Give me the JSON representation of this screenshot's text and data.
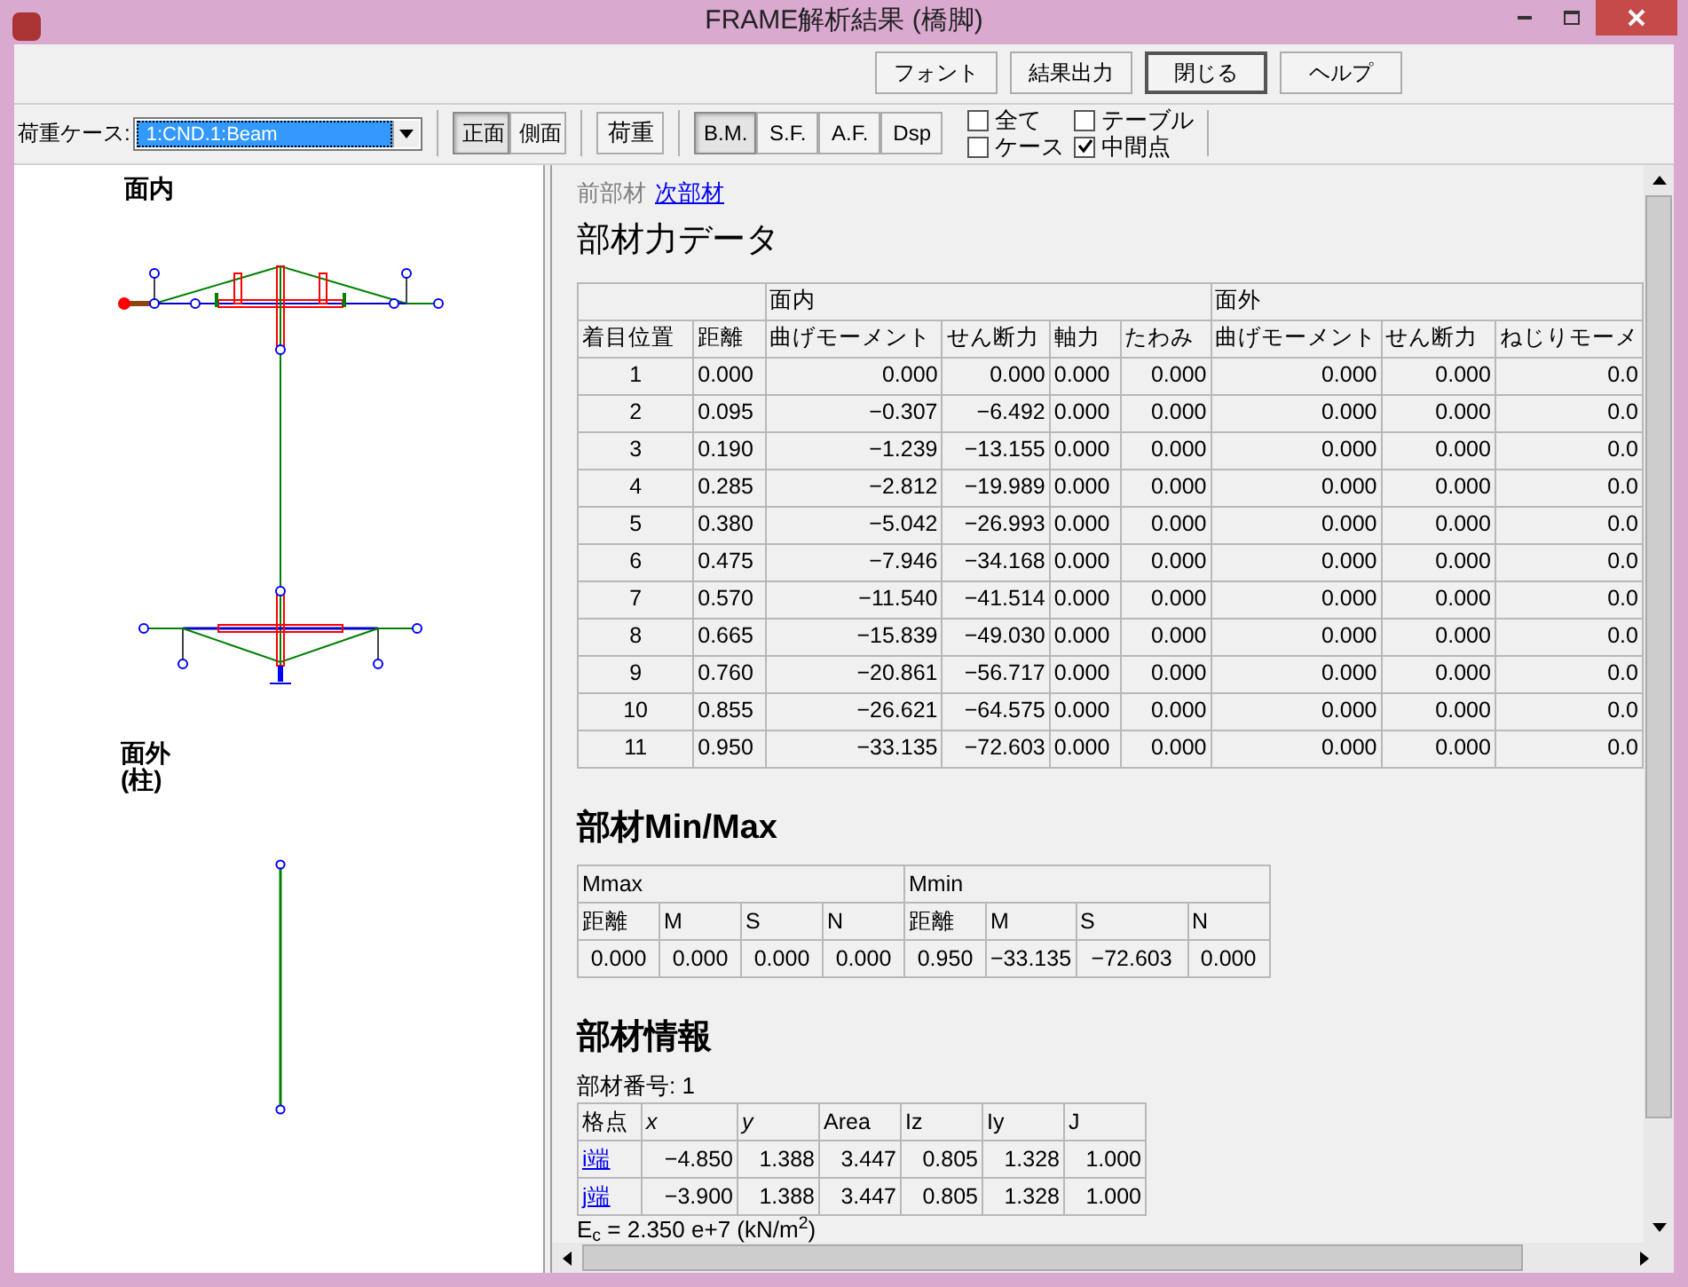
{
  "window": {
    "title": "FRAME解析結果 (橋脚)"
  },
  "top_buttons": [
    {
      "label": "フォント",
      "default": false
    },
    {
      "label": "結果出力",
      "default": false
    },
    {
      "label": "閉じる",
      "default": true
    },
    {
      "label": "ヘルプ",
      "default": false
    }
  ],
  "toolbar": {
    "load_case_label": "荷重ケース:",
    "load_case_value": "1:CND.1:Beam",
    "view_buttons": [
      {
        "label": "正面",
        "selected": true
      },
      {
        "label": "側面",
        "selected": false
      }
    ],
    "load_button": "荷重",
    "result_buttons": [
      {
        "label": "B.M.",
        "selected": true
      },
      {
        "label": "S.F.",
        "selected": false
      },
      {
        "label": "A.F.",
        "selected": false
      },
      {
        "label": "Dsp",
        "selected": false
      }
    ],
    "checkboxes": [
      {
        "label": "全て",
        "checked": false
      },
      {
        "label": "テーブル",
        "checked": false
      },
      {
        "label": "ケース",
        "checked": false
      },
      {
        "label": "中間点",
        "checked": true
      }
    ]
  },
  "diagram": {
    "in_plane_label": "面内",
    "out_plane_label": [
      "面外",
      "(柱)"
    ]
  },
  "nav": [
    {
      "label": "前部材",
      "disabled": true
    },
    {
      "label": "次部材",
      "disabled": false
    }
  ],
  "force_section": {
    "title": "部材力データ",
    "groups": [
      "面内",
      "面外"
    ],
    "columns": [
      "着目位置",
      "距離",
      "曲げモーメント",
      "せん断力",
      "軸力",
      "たわみ",
      "曲げモーメント",
      "せん断力",
      "ねじりモーメ"
    ],
    "rows": [
      [
        "1",
        "0.000",
        "0.000",
        "0.000",
        "0.000",
        "0.000",
        "0.000",
        "0.000",
        "0.0"
      ],
      [
        "2",
        "0.095",
        "−0.307",
        "−6.492",
        "0.000",
        "0.000",
        "0.000",
        "0.000",
        "0.0"
      ],
      [
        "3",
        "0.190",
        "−1.239",
        "−13.155",
        "0.000",
        "0.000",
        "0.000",
        "0.000",
        "0.0"
      ],
      [
        "4",
        "0.285",
        "−2.812",
        "−19.989",
        "0.000",
        "0.000",
        "0.000",
        "0.000",
        "0.0"
      ],
      [
        "5",
        "0.380",
        "−5.042",
        "−26.993",
        "0.000",
        "0.000",
        "0.000",
        "0.000",
        "0.0"
      ],
      [
        "6",
        "0.475",
        "−7.946",
        "−34.168",
        "0.000",
        "0.000",
        "0.000",
        "0.000",
        "0.0"
      ],
      [
        "7",
        "0.570",
        "−11.540",
        "−41.514",
        "0.000",
        "0.000",
        "0.000",
        "0.000",
        "0.0"
      ],
      [
        "8",
        "0.665",
        "−15.839",
        "−49.030",
        "0.000",
        "0.000",
        "0.000",
        "0.000",
        "0.0"
      ],
      [
        "9",
        "0.760",
        "−20.861",
        "−56.717",
        "0.000",
        "0.000",
        "0.000",
        "0.000",
        "0.0"
      ],
      [
        "10",
        "0.855",
        "−26.621",
        "−64.575",
        "0.000",
        "0.000",
        "0.000",
        "0.000",
        "0.0"
      ],
      [
        "11",
        "0.950",
        "−33.135",
        "−72.603",
        "0.000",
        "0.000",
        "0.000",
        "0.000",
        "0.0"
      ]
    ]
  },
  "minmax_section": {
    "title": "部材Min/Max",
    "groups": [
      "Mmax",
      "Mmin"
    ],
    "columns": [
      "距離",
      "M",
      "S",
      "N",
      "距離",
      "M",
      "S",
      "N"
    ],
    "values": [
      "0.000",
      "0.000",
      "0.000",
      "0.000",
      "0.950",
      "−33.135",
      "−72.603",
      "0.000"
    ]
  },
  "info_section": {
    "title": "部材情報",
    "member_number": "部材番号: 1",
    "columns": [
      "格点",
      "x",
      "y",
      "Area",
      "Iz",
      "Iy",
      "J"
    ],
    "rows": [
      [
        "i端",
        "−4.850",
        "1.388",
        "3.447",
        "0.805",
        "1.328",
        "1.000"
      ],
      [
        "j端",
        "−3.900",
        "1.388",
        "3.447",
        "0.805",
        "1.328",
        "1.000"
      ]
    ],
    "note": "E$_{c}$ = 2.350 e+7 (kN/m$^{2}$)"
  }
}
